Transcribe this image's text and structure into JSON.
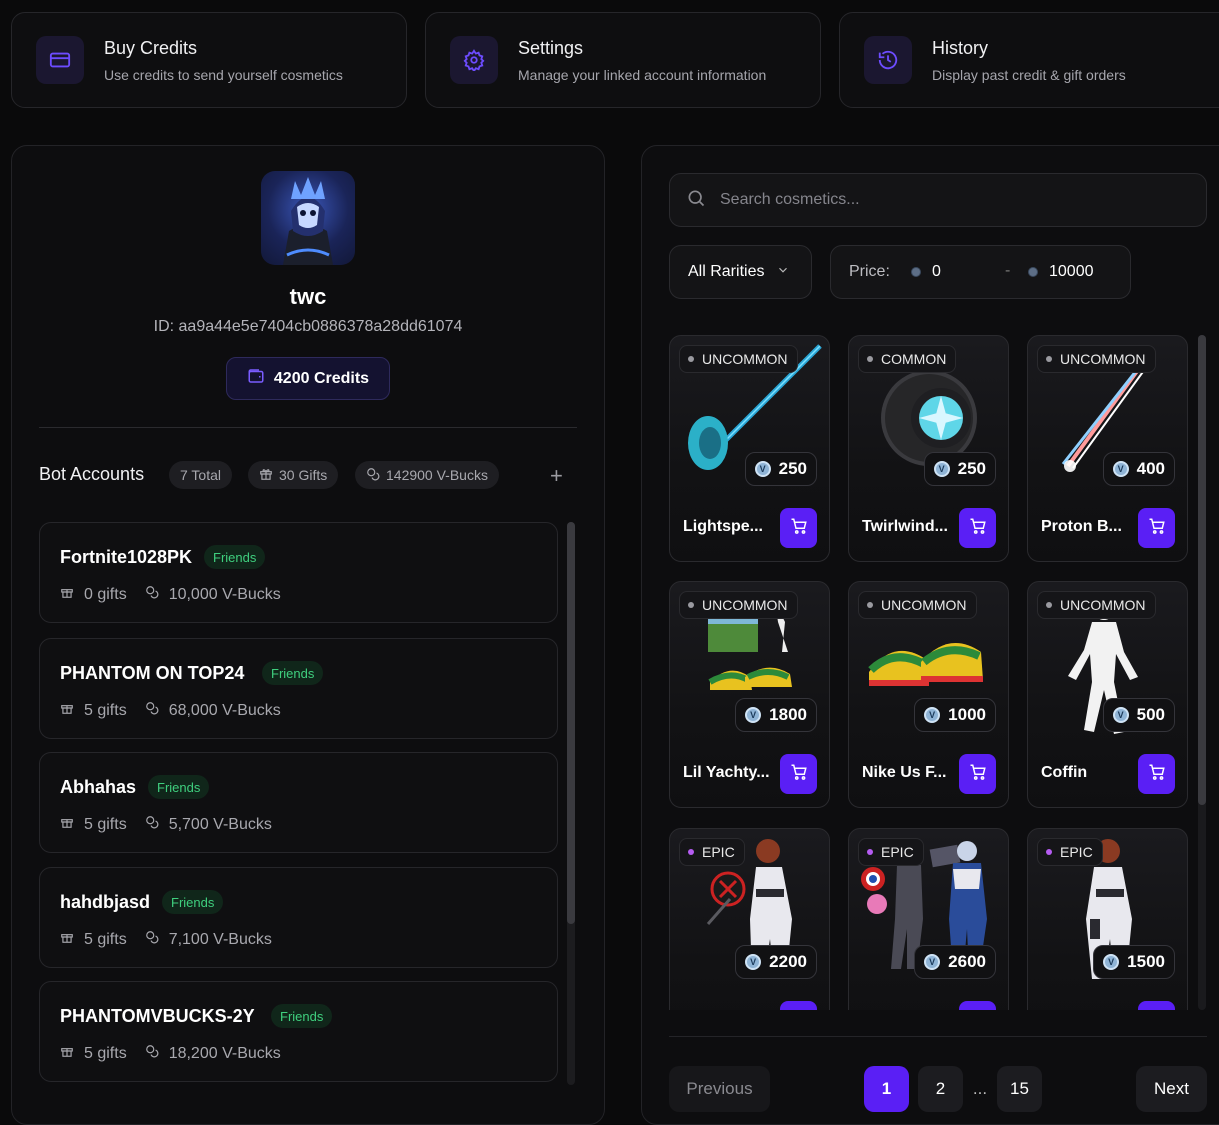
{
  "top_cards": [
    {
      "title": "Buy Credits",
      "subtitle": "Use credits to send yourself cosmetics",
      "icon": "credit-card-icon"
    },
    {
      "title": "Settings",
      "subtitle": "Manage your linked account information",
      "icon": "gear-icon"
    },
    {
      "title": "History",
      "subtitle": "Display past credit & gift orders",
      "icon": "history-icon"
    }
  ],
  "profile": {
    "username": "twc",
    "id": "ID: aa9a44e5e7404cb0886378a28dd61074",
    "credits": "4200 Credits"
  },
  "bots": {
    "title": "Bot Accounts",
    "total": "7 Total",
    "gifts": "30 Gifts",
    "vbucks": "142900 V-Bucks",
    "accounts": [
      {
        "name": "Fortnite1028PK",
        "status": "Friends",
        "gifts": "0 gifts",
        "vbucks": "10,000 V-Bucks"
      },
      {
        "name": "PHANTOM ON TOP24",
        "status": "Friends",
        "gifts": "5 gifts",
        "vbucks": "68,000 V-Bucks"
      },
      {
        "name": "Abhahas",
        "status": "Friends",
        "gifts": "5 gifts",
        "vbucks": "5,700 V-Bucks"
      },
      {
        "name": "hahdbjasd",
        "status": "Friends",
        "gifts": "5 gifts",
        "vbucks": "7,100 V-Bucks"
      },
      {
        "name": "PHANTOMVBUCKS-2Y",
        "status": "Friends",
        "gifts": "5 gifts",
        "vbucks": "18,200 V-Bucks"
      }
    ]
  },
  "shop": {
    "search_placeholder": "Search cosmetics...",
    "rarity_filter": "All Rarities",
    "price_label": "Price:",
    "price_min": "0",
    "price_max": "10000",
    "items": [
      {
        "rarity": "UNCOMMON",
        "price": "250",
        "name": "Lightspe...",
        "rarity_color": "#9a9aa0"
      },
      {
        "rarity": "COMMON",
        "price": "250",
        "name": "Twirlwind...",
        "rarity_color": "#9a9aa0"
      },
      {
        "rarity": "UNCOMMON",
        "price": "400",
        "name": "Proton B...",
        "rarity_color": "#9a9aa0"
      },
      {
        "rarity": "UNCOMMON",
        "price": "1800",
        "name": "Lil Yachty...",
        "rarity_color": "#9a9aa0"
      },
      {
        "rarity": "UNCOMMON",
        "price": "1000",
        "name": "Nike Us F...",
        "rarity_color": "#9a9aa0"
      },
      {
        "rarity": "UNCOMMON",
        "price": "500",
        "name": "Coffin",
        "rarity_color": "#9a9aa0"
      },
      {
        "rarity": "EPIC",
        "price": "2200",
        "name": "",
        "rarity_color": "#b65cf2"
      },
      {
        "rarity": "EPIC",
        "price": "2600",
        "name": "",
        "rarity_color": "#b65cf2"
      },
      {
        "rarity": "EPIC",
        "price": "1500",
        "name": "",
        "rarity_color": "#b65cf2"
      }
    ]
  },
  "pagination": {
    "previous": "Previous",
    "pages": [
      "1",
      "2",
      "...",
      "15"
    ],
    "current": "1",
    "next": "Next"
  },
  "colors": {
    "accent": "#5a1ff5",
    "friends_badge": "#3fcf7e"
  }
}
